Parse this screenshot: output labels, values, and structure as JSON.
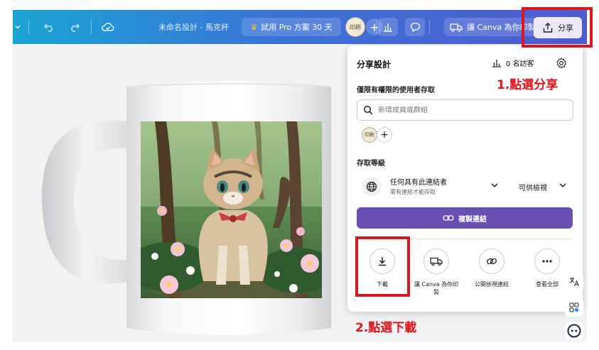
{
  "topbar": {
    "title": "未命名設計 - 馬克杯",
    "trial_button": "試用 Pro 方案 30 天",
    "avatar_text": "印刷",
    "print_button": "讓 Canva 為你印製",
    "share_button": "分享"
  },
  "share_panel": {
    "title": "分享設計",
    "visitors": "0 名訪客",
    "restricted_label": "僅限有權限的使用者存取",
    "search_placeholder": "新增成員或群組",
    "member_avatar": "印刷",
    "access_level_label": "存取等級",
    "access_option": "任何具有此連結者",
    "access_option_sub": "需有連結才能存取",
    "permission": "可供檢視",
    "copy_link_button": "複製連結",
    "actions": [
      {
        "label": "下載",
        "icon": "download-icon"
      },
      {
        "label": "讓 Canva 為你印製",
        "icon": "truck-icon"
      },
      {
        "label": "公開檢視連結",
        "icon": "link-icon"
      },
      {
        "label": "查看全部",
        "icon": "more-icon"
      }
    ]
  },
  "annotations": {
    "step1": "1.點選分享",
    "step2": "2.點選下載"
  },
  "colors": {
    "topbar_start": "#1aa4d4",
    "topbar_end": "#4f5bd0",
    "primary_button": "#6a4fb3",
    "annotation": "#d81820"
  }
}
